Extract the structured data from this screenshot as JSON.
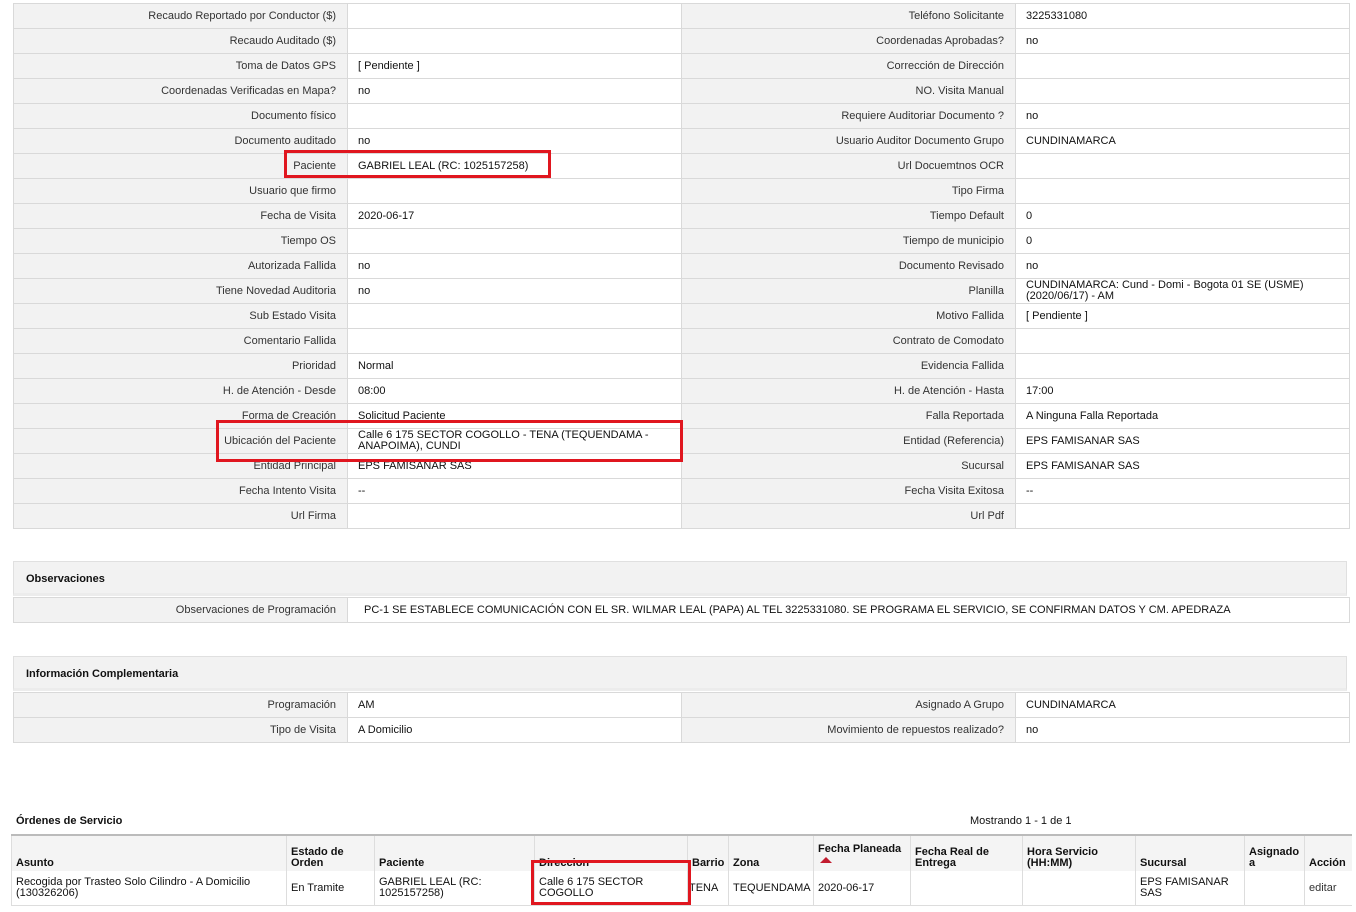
{
  "details": {
    "rows": [
      {
        "l1": "Recaudo Reportado por Conductor ($)",
        "v1": "",
        "l2": "Teléfono Solicitante",
        "v2": "3225331080"
      },
      {
        "l1": "Recaudo Auditado ($)",
        "v1": "",
        "l2": "Coordenadas Aprobadas?",
        "v2": "no"
      },
      {
        "l1": "Toma de Datos GPS",
        "v1": "[ Pendiente ]",
        "l2": "Corrección de Dirección",
        "v2": ""
      },
      {
        "l1": "Coordenadas Verificadas en Mapa?",
        "v1": "no",
        "l2": "NO. Visita Manual",
        "v2": ""
      },
      {
        "l1": "Documento físico",
        "v1": "",
        "l2": "Requiere Auditoriar Documento ?",
        "v2": "no"
      },
      {
        "l1": "Documento auditado",
        "v1": "no",
        "l2": "Usuario Auditor Documento Grupo",
        "v2": "CUNDINAMARCA"
      },
      {
        "l1": "Paciente",
        "v1": "GABRIEL LEAL (RC: 1025157258)",
        "l2": "Url Docuemtnos OCR",
        "v2": ""
      },
      {
        "l1": "Usuario que firmo",
        "v1": "",
        "l2": "Tipo Firma",
        "v2": ""
      },
      {
        "l1": "Fecha de Visita",
        "v1": "2020-06-17",
        "l2": "Tiempo Default",
        "v2": "0"
      },
      {
        "l1": "Tiempo OS",
        "v1": "",
        "l2": "Tiempo de municipio",
        "v2": "0"
      },
      {
        "l1": "Autorizada Fallida",
        "v1": "no",
        "l2": "Documento Revisado",
        "v2": "no"
      },
      {
        "l1": "Tiene Novedad Auditoria",
        "v1": "no",
        "l2": "Planilla",
        "v2": "CUNDINAMARCA: Cund - Domi - Bogota 01 SE (USME) (2020/06/17) - AM"
      },
      {
        "l1": "Sub Estado Visita",
        "v1": "",
        "l2": "Motivo Fallida",
        "v2": "[ Pendiente ]"
      },
      {
        "l1": "Comentario Fallida",
        "v1": "",
        "l2": "Contrato de Comodato",
        "v2": ""
      },
      {
        "l1": "Prioridad",
        "v1": "Normal",
        "l2": "Evidencia Fallida",
        "v2": ""
      },
      {
        "l1": "H. de Atención - Desde",
        "v1": "08:00",
        "l2": "H. de Atención - Hasta",
        "v2": "17:00"
      },
      {
        "l1": "Forma de Creación",
        "v1": "Solicitud Paciente",
        "l2": "Falla Reportada",
        "v2": "A Ninguna Falla Reportada"
      },
      {
        "l1": "Ubicación del Paciente",
        "v1": "Calle 6 175 SECTOR COGOLLO - TENA (TEQUENDAMA - ANAPOIMA), CUNDI",
        "l2": "Entidad (Referencia)",
        "v2": "EPS FAMISANAR SAS"
      },
      {
        "l1": "Entidad Principal",
        "v1": "EPS FAMISANAR SAS",
        "l2": "Sucursal",
        "v2": "EPS FAMISANAR SAS"
      },
      {
        "l1": "Fecha Intento Visita",
        "v1": "--",
        "l2": "Fecha Visita Exitosa",
        "v2": "--"
      },
      {
        "l1": "Url Firma",
        "v1": "",
        "l2": "Url Pdf",
        "v2": ""
      }
    ]
  },
  "observaciones": {
    "title": "Observaciones",
    "label": "Observaciones de Programación",
    "value": "PC-1 SE ESTABLECE COMUNICACIÓN CON EL SR. WILMAR LEAL (PAPA) AL TEL 3225331080. SE PROGRAMA EL SERVICIO, SE CONFIRMAN DATOS Y CM. APEDRAZA"
  },
  "complementaria": {
    "title": "Información Complementaria",
    "rows": [
      {
        "l1": "Programación",
        "v1": "AM",
        "l2": "Asignado A Grupo",
        "v2": "CUNDINAMARCA"
      },
      {
        "l1": "Tipo de Visita",
        "v1": "A Domicilio",
        "l2": "Movimiento de repuestos realizado?",
        "v2": "no"
      }
    ]
  },
  "ordenes": {
    "title": "Órdenes de Servicio",
    "count_text": "Mostrando 1 - 1 de 1",
    "headers": [
      "Asunto",
      "Estado de Orden",
      "Paciente",
      "Direccion",
      "Barrio",
      "Zona",
      "Fecha Planeada",
      "Fecha Real de Entrega",
      "Hora Servicio (HH:MM)",
      "Sucursal",
      "Asignado a",
      "Acción"
    ],
    "rows": [
      {
        "asunto": "Recogida por Trasteo Solo Cilindro - A Domicilio (130326206)",
        "estado": "En Tramite",
        "paciente": "GABRIEL LEAL (RC: 1025157258)",
        "direccion": "Calle 6 175 SECTOR COGOLLO",
        "barrio": "TENA",
        "zona": "TEQUENDAMA",
        "fecha_planeada": "2020-06-17",
        "fecha_real": "",
        "hora": "",
        "sucursal": "EPS FAMISANAR SAS",
        "asignado": "",
        "accion": "editar"
      }
    ]
  },
  "colors": {
    "highlight": "#e0161f",
    "label_bg": "#f2f2f2",
    "border": "#d9d9d9",
    "sort_arrow": "#c21c2f"
  }
}
